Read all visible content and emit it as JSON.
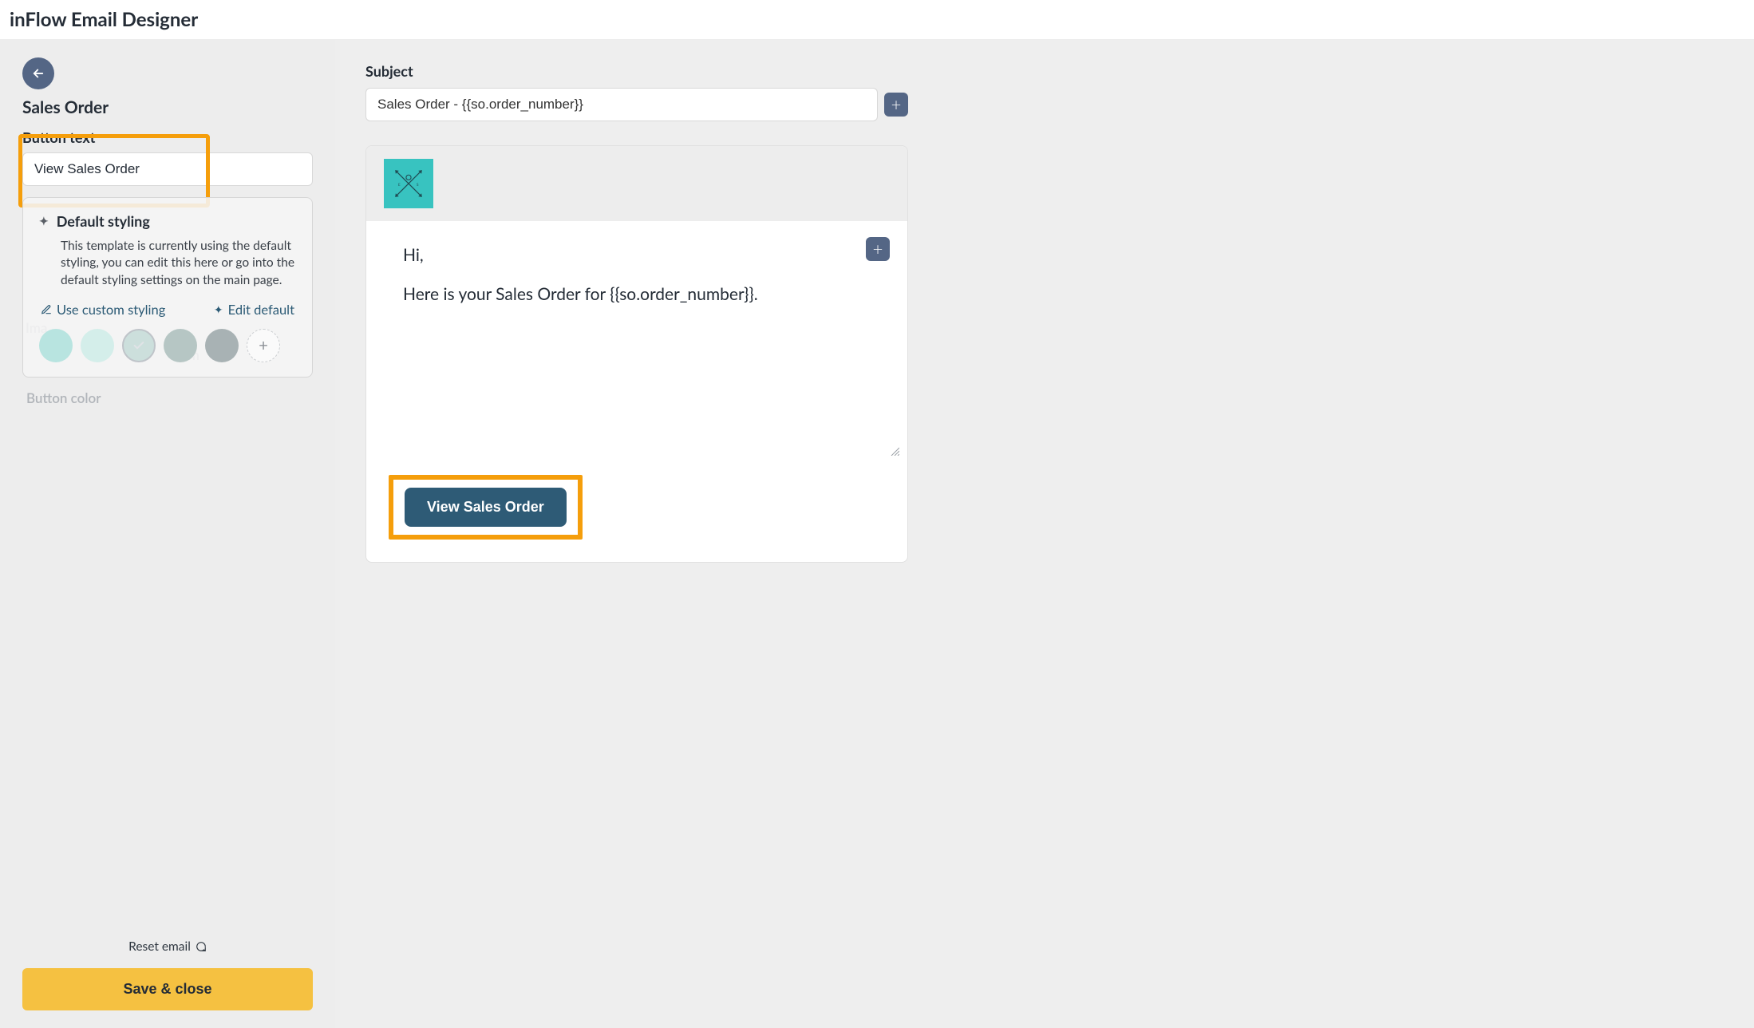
{
  "app": {
    "title": "inFlow Email Designer"
  },
  "sidebar": {
    "template_name": "Sales Order",
    "field_label": "Button text",
    "button_text_value": "View Sales Order",
    "styling": {
      "title": "Default styling",
      "description": "This template is currently using the default styling, you can edit this here or go into the default styling settings on the main page.",
      "custom_link": "Use custom styling",
      "edit_default_link": "Edit default"
    },
    "ghost_labels": {
      "ima": "Ima",
      "ium": "ium",
      "button_color": "Button color"
    },
    "swatches": {
      "colors": [
        "#b8e4e0",
        "#d4eeea",
        "#ccdfdc",
        "#b6c6c4",
        "#a8b2b4"
      ],
      "selected_index": 2
    },
    "reset_label": "Reset email",
    "save_label": "Save & close"
  },
  "preview": {
    "subject_label": "Subject",
    "subject_value": "Sales Order - {{so.order_number}}",
    "greeting": "Hi,",
    "body_line": "Here is your Sales Order for {{so.order_number}}.",
    "cta_label": "View Sales Order"
  }
}
